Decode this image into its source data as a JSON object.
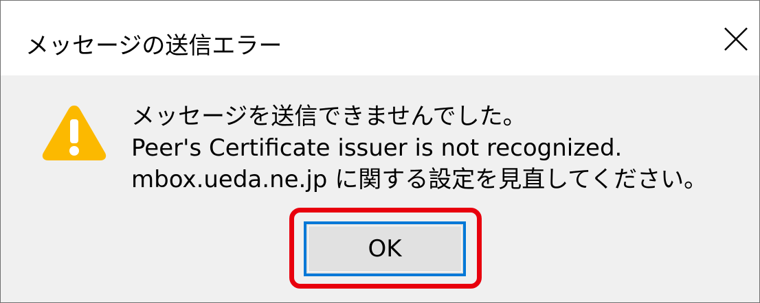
{
  "dialog": {
    "title": "メッセージの送信エラー",
    "icons": {
      "close": "close-x-icon",
      "warning": "warning-triangle-icon"
    },
    "message_lines": [
      "メッセージを送信できませんでした。",
      "Peer's Certificate issuer is not recognized.",
      "mbox.ueda.ne.jp に関する設定を見直してください。"
    ],
    "ok_label": "OK"
  },
  "colors": {
    "warning": "#fcb900",
    "focus_border": "#0078d7",
    "highlight": "#e8000d",
    "dialog_bg": "#f0f0f0"
  }
}
